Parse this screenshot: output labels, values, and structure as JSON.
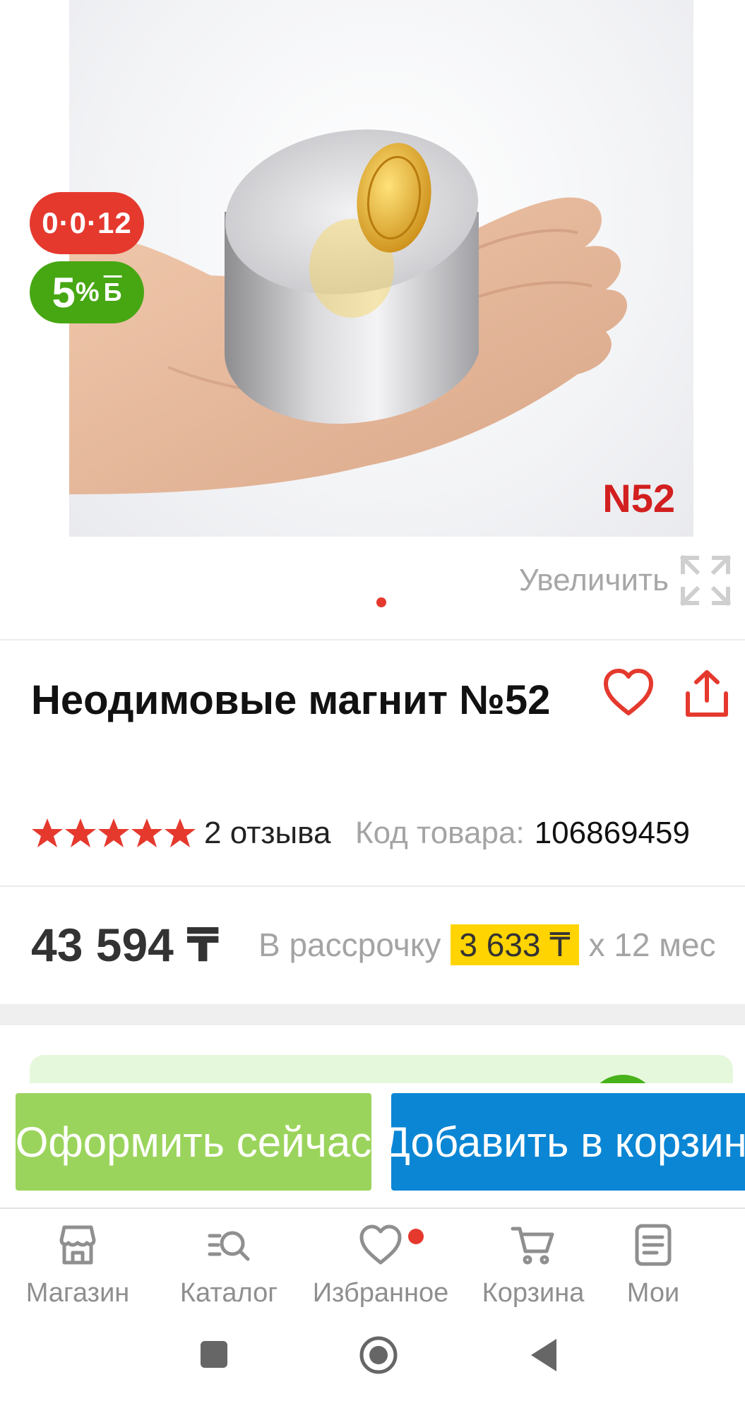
{
  "gallery": {
    "image_label": "N52",
    "badge_installment": "0·0·12",
    "badge_bonus_value": "5",
    "badge_bonus_percent": "%",
    "badge_bonus_currency": "Б",
    "zoom_label": "Увеличить",
    "page_count": 1,
    "active_page": 1
  },
  "product": {
    "title": "Неодимовые магнит №52",
    "rating": 5,
    "reviews": "2 отзыва",
    "code_label": "Код товара:",
    "code_value": "106869459"
  },
  "pricing": {
    "price": "43 594 ₸",
    "installment_label": "В рассрочку",
    "installment_amount": "3 633 ₸",
    "installment_term": "х 12 мес"
  },
  "actions": {
    "checkout_label": "Оформить сейчас",
    "add_to_cart_label": "Добавить в корзину"
  },
  "tabbar": {
    "items": [
      {
        "label": "Магазин",
        "icon": "store-icon"
      },
      {
        "label": "Каталог",
        "icon": "catalog-search-icon"
      },
      {
        "label": "Избранное",
        "icon": "heart-icon",
        "has_dot": true
      },
      {
        "label": "Корзина",
        "icon": "cart-icon"
      },
      {
        "label": "Мои",
        "icon": "orders-list-icon"
      }
    ]
  },
  "colors": {
    "accent_red": "#e5392e",
    "bonus_green": "#47a713",
    "checkout_green": "#9bd45c",
    "cart_blue": "#0b86d4",
    "installment_yellow": "#ffd400"
  }
}
